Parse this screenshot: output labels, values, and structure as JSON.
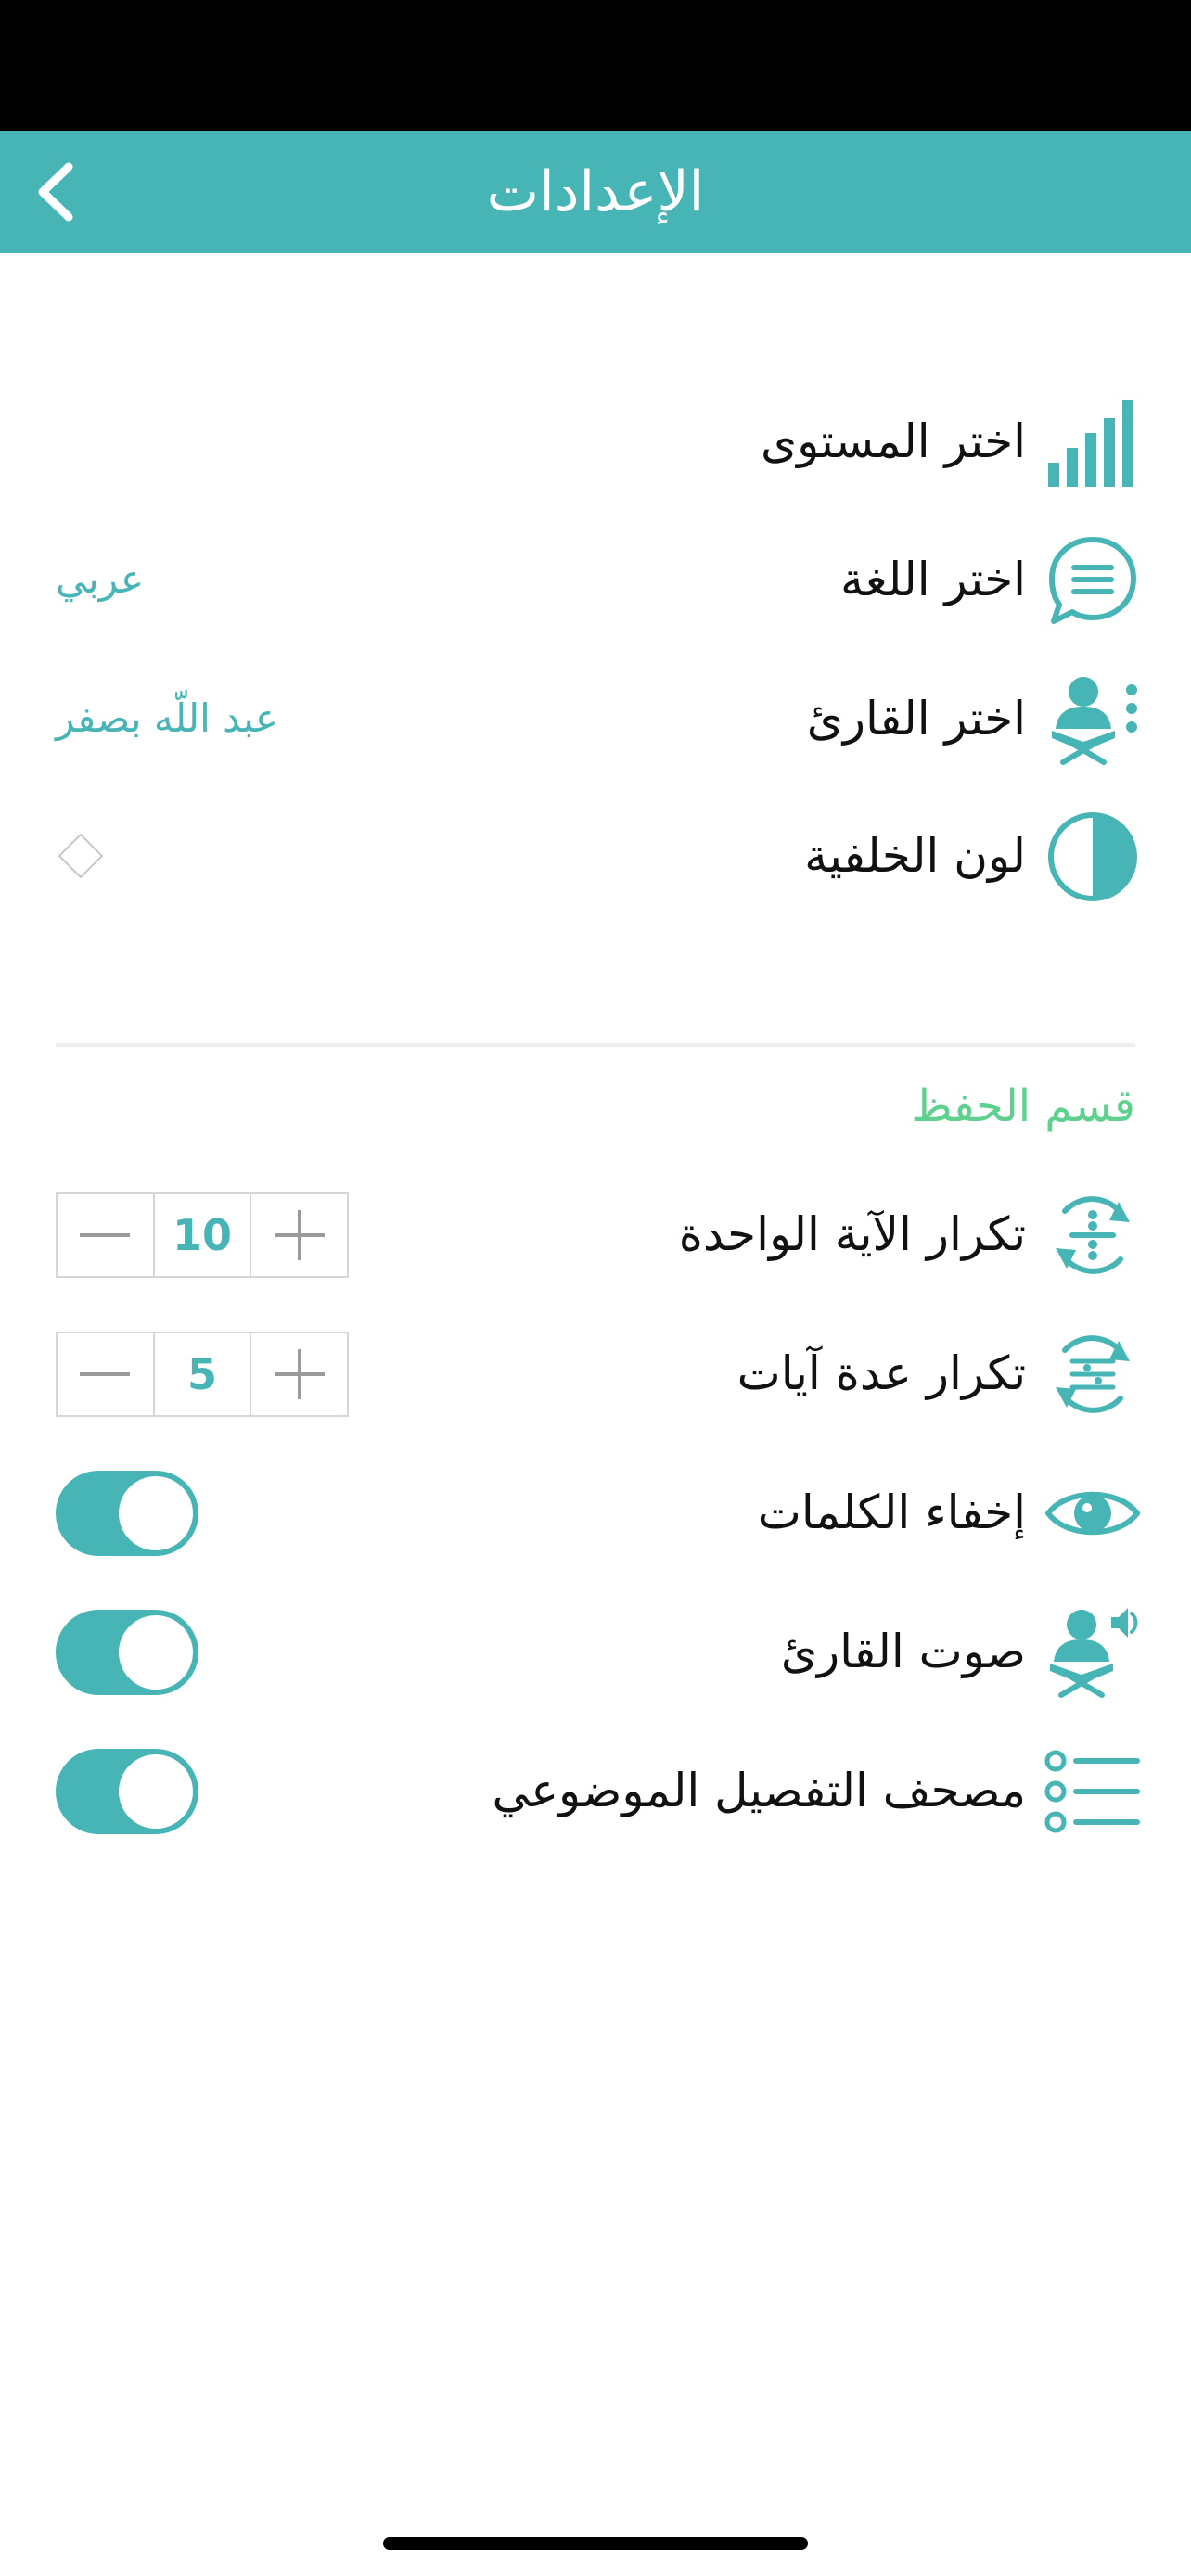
{
  "header": {
    "title": "الإعدادات",
    "back_icon": "chevron-left-icon"
  },
  "settings": [
    {
      "label": "اختر المستوى",
      "icon": "level-bars-icon",
      "value": ""
    },
    {
      "label": "اختر اللغة",
      "icon": "chat-bubble-icon",
      "value": "عربي"
    },
    {
      "label": "اختر القارئ",
      "icon": "reciter-icon",
      "value": "عبد اللّه بصفر"
    },
    {
      "label": "لون الخلفية",
      "icon": "contrast-icon",
      "value": ""
    }
  ],
  "memorization": {
    "section_title": "قسم الحفظ",
    "single_verse_repeat": {
      "label": "تكرار الآية الواحدة",
      "icon": "repeat-verse-icon",
      "value": "10"
    },
    "multi_verse_repeat": {
      "label": "تكرار عدة آيات",
      "icon": "repeat-verses-icon",
      "value": "5"
    },
    "hide_words": {
      "label": "إخفاء الكلمات",
      "icon": "eye-icon",
      "on": true
    },
    "reciter_voice": {
      "label": "صوت القارئ",
      "icon": "reciter-voice-icon",
      "on": true
    },
    "topical_mushaf": {
      "label": "مصحف التفصيل الموضوعي",
      "icon": "list-icon",
      "on": true
    }
  },
  "colors": {
    "accent": "#47b5b5",
    "section": "#5fd08f",
    "divider": "#eeeeee"
  }
}
